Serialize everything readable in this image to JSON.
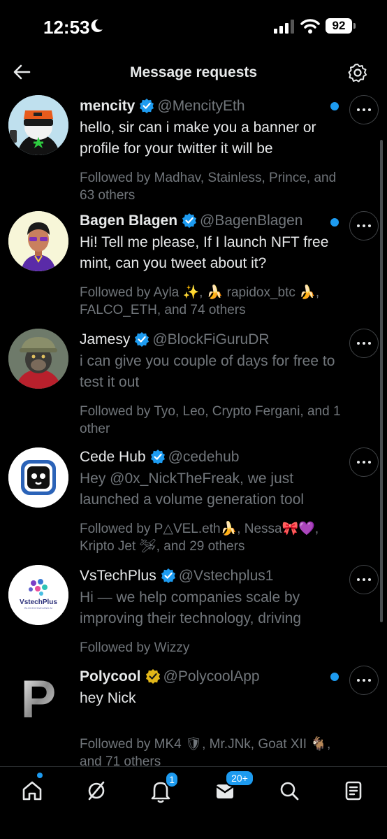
{
  "status_bar": {
    "time": "12:53",
    "battery": "92"
  },
  "header": {
    "title": "Message requests"
  },
  "requests": [
    {
      "name": "mencity",
      "handle": "@MencityEth",
      "message": "hello, sir can i make you a banner or profile for your twitter it will be",
      "followed_by": "Followed by Madhav, Stainless, Prince, and 63 others",
      "unread": true,
      "verified": "blue"
    },
    {
      "name": "Bagen Blagen",
      "handle": "@BagenBlagen",
      "message": "Hi! Tell me please, If I launch NFT free mint, can you tweet about it?",
      "followed_by": "Followed by Ayla ✨, 🍌 rapidox_btc 🍌, FALCO_ETH, and 74 others",
      "unread": true,
      "verified": "blue"
    },
    {
      "name": "Jamesy",
      "handle": "@BlockFiGuruDR",
      "message": "i can give you couple of days for free to test it out",
      "followed_by": "Followed by Tyo, Leo, Crypto Fergani, and 1 other",
      "unread": false,
      "verified": "blue"
    },
    {
      "name": "Cede Hub",
      "handle": "@cedehub",
      "message": "Hey @0x_NickTheFreak, we just launched a volume generation tool",
      "followed_by": "Followed by P△VEL.eth🍌, Nessa🎀💜, Kripto Jet 🛩, and 29 others",
      "unread": false,
      "verified": "blue"
    },
    {
      "name": "VsTechPlus",
      "handle": "@Vstechplus1",
      "message": "Hi — we help companies scale by improving their technology, driving",
      "followed_by": "Followed by Wizzy",
      "unread": false,
      "verified": "blue"
    },
    {
      "name": "Polycool",
      "handle": "@PolycoolApp",
      "message": "hey Nick",
      "followed_by": "Followed by MK4 🛡, Mr.JNk, Goat XII 🐐, and 71 others",
      "unread": true,
      "verified": "gold"
    }
  ],
  "avatars": {
    "vstech_text": "VstechPlus",
    "vstech_sub": "BLOCKCHAIN AND AI",
    "polycool_letter": "P"
  },
  "nav": {
    "tabs": [
      "home-icon",
      "grok-icon",
      "notifications-icon",
      "messages-icon",
      "search-icon",
      "communities-icon"
    ],
    "notifications_badge": "1",
    "messages_badge": "20+"
  },
  "colors": {
    "accent": "#1d9bf0",
    "gold": "#e2b719",
    "background": "#000000",
    "muted": "#71767b"
  }
}
